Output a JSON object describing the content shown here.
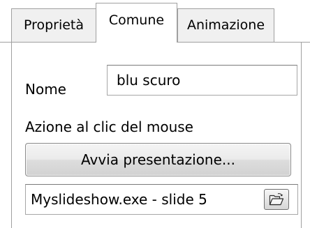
{
  "tabs": [
    {
      "label": "Proprietà",
      "active": false
    },
    {
      "label": "Comune",
      "active": true
    },
    {
      "label": "Animazione",
      "active": false
    }
  ],
  "form": {
    "name_label": "Nome",
    "name_value": "blu scuro",
    "action_label": "Azione al clic del mouse",
    "action_button_label": "Avvia presentazione...",
    "file_value": "Myslideshow.exe - slide 5",
    "browse_icon": "open-folder-icon"
  }
}
